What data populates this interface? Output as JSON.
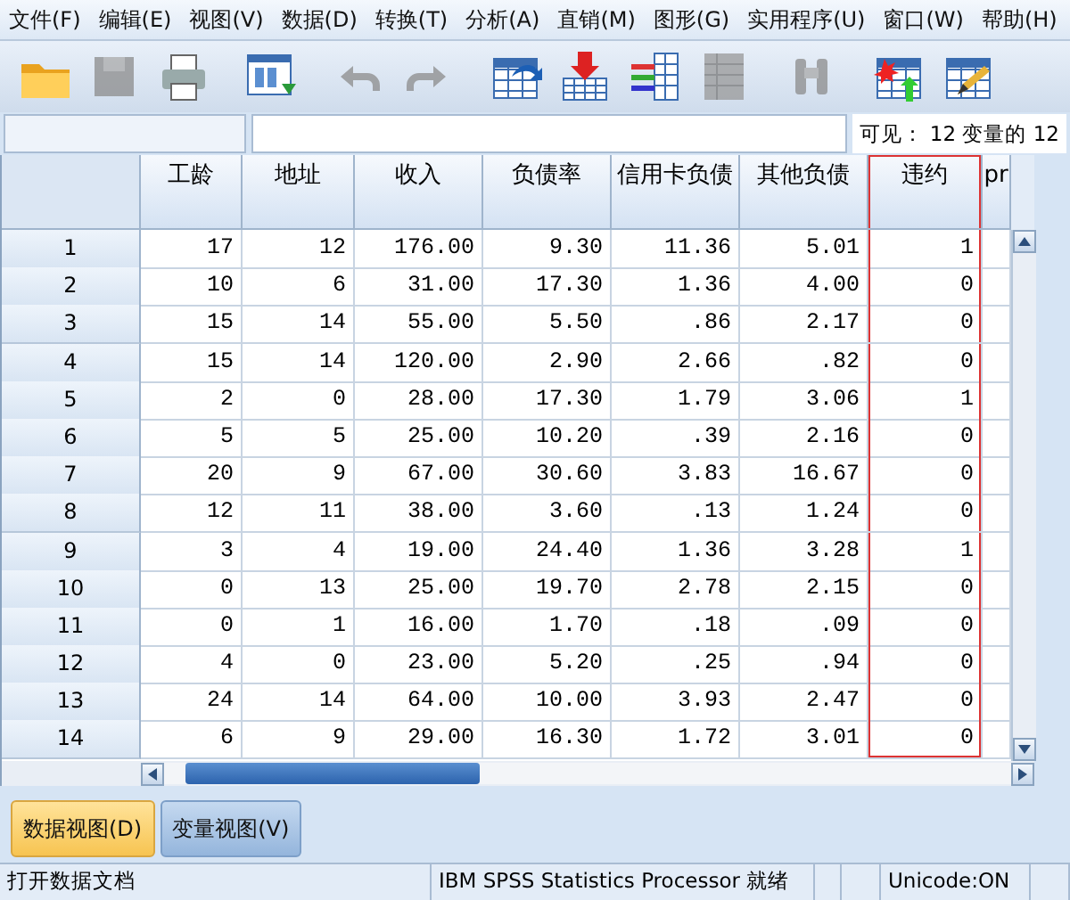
{
  "menu": [
    "文件(F)",
    "编辑(E)",
    "视图(V)",
    "数据(D)",
    "转换(T)",
    "分析(A)",
    "直销(M)",
    "图形(G)",
    "实用程序(U)",
    "窗口(W)",
    "帮助(H)"
  ],
  "toolbar": [
    {
      "kind": "folder",
      "disabled": false
    },
    {
      "kind": "floppy",
      "disabled": true
    },
    {
      "kind": "printer",
      "disabled": false
    },
    {
      "kind": "dialog",
      "disabled": false
    },
    {
      "kind": "undo",
      "disabled": true
    },
    {
      "kind": "redo",
      "disabled": true
    },
    {
      "kind": "table-arrow",
      "disabled": false
    },
    {
      "kind": "table-down",
      "disabled": false
    },
    {
      "kind": "table-lines",
      "disabled": false
    },
    {
      "kind": "table-grid",
      "disabled": true
    },
    {
      "kind": "binoculars",
      "disabled": true
    },
    {
      "kind": "table-star",
      "disabled": false
    },
    {
      "kind": "table-pencil",
      "disabled": false
    }
  ],
  "visible_info": "可见： 12 变量的 12",
  "columns": [
    {
      "label": "工龄",
      "highlighted": false
    },
    {
      "label": "地址",
      "highlighted": false
    },
    {
      "label": "收入",
      "highlighted": false
    },
    {
      "label": "负债率",
      "highlighted": false
    },
    {
      "label": "信用卡负债",
      "highlighted": false
    },
    {
      "label": "其他负债",
      "highlighted": false
    },
    {
      "label": "违约",
      "highlighted": true
    },
    {
      "label": "pr",
      "highlighted": false
    }
  ],
  "rows": [
    {
      "n": "1",
      "cells": [
        "17",
        "12",
        "176.00",
        "9.30",
        "11.36",
        "5.01",
        "1"
      ]
    },
    {
      "n": "2",
      "cells": [
        "10",
        "6",
        "31.00",
        "17.30",
        "1.36",
        "4.00",
        "0"
      ]
    },
    {
      "n": "3",
      "cells": [
        "15",
        "14",
        "55.00",
        "5.50",
        ".86",
        "2.17",
        "0"
      ]
    },
    {
      "n": "4",
      "cells": [
        "15",
        "14",
        "120.00",
        "2.90",
        "2.66",
        ".82",
        "0"
      ]
    },
    {
      "n": "5",
      "cells": [
        "2",
        "0",
        "28.00",
        "17.30",
        "1.79",
        "3.06",
        "1"
      ]
    },
    {
      "n": "6",
      "cells": [
        "5",
        "5",
        "25.00",
        "10.20",
        ".39",
        "2.16",
        "0"
      ]
    },
    {
      "n": "7",
      "cells": [
        "20",
        "9",
        "67.00",
        "30.60",
        "3.83",
        "16.67",
        "0"
      ]
    },
    {
      "n": "8",
      "cells": [
        "12",
        "11",
        "38.00",
        "3.60",
        ".13",
        "1.24",
        "0"
      ]
    },
    {
      "n": "9",
      "cells": [
        "3",
        "4",
        "19.00",
        "24.40",
        "1.36",
        "3.28",
        "1"
      ]
    },
    {
      "n": "10",
      "cells": [
        "0",
        "13",
        "25.00",
        "19.70",
        "2.78",
        "2.15",
        "0"
      ]
    },
    {
      "n": "11",
      "cells": [
        "0",
        "1",
        "16.00",
        "1.70",
        ".18",
        ".09",
        "0"
      ]
    },
    {
      "n": "12",
      "cells": [
        "4",
        "0",
        "23.00",
        "5.20",
        ".25",
        ".94",
        "0"
      ]
    },
    {
      "n": "13",
      "cells": [
        "24",
        "14",
        "64.00",
        "10.00",
        "3.93",
        "2.47",
        "0"
      ]
    },
    {
      "n": "14",
      "cells": [
        "6",
        "9",
        "29.00",
        "16.30",
        "1.72",
        "3.01",
        "0"
      ]
    }
  ],
  "view_tabs": [
    {
      "label": "数据视图(D)",
      "selected": true
    },
    {
      "label": "变量视图(V)",
      "selected": false
    }
  ],
  "status_bar": [
    "打开数据文档",
    "IBM SPSS Statistics Processor 就绪",
    "Unicode:ON"
  ]
}
